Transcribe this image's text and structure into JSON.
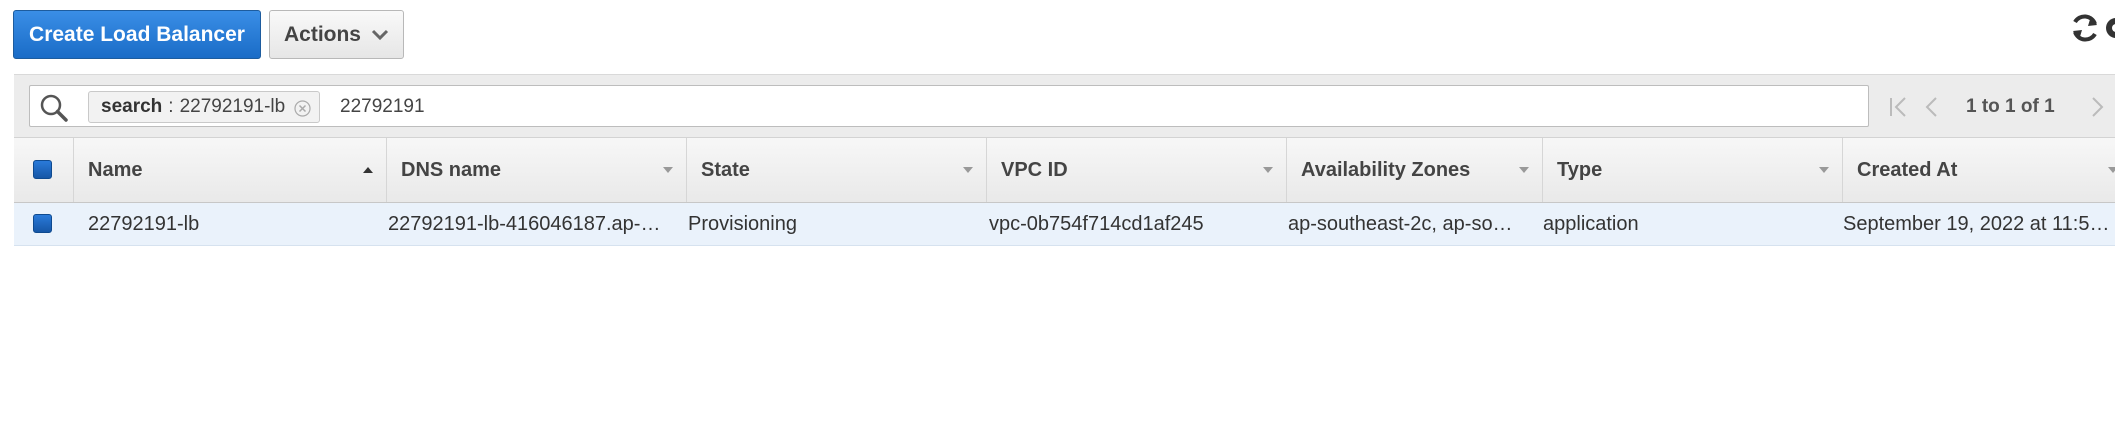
{
  "toolbar": {
    "create_label": "Create Load Balancer",
    "actions_label": "Actions",
    "refresh_icon": "refresh-icon",
    "settings_icon": "gear-icon"
  },
  "filter": {
    "token_key": "search",
    "token_separator": ":",
    "token_value": "22792191-lb",
    "query": "22792191"
  },
  "pagination": {
    "text": "1 to 1 of 1"
  },
  "table": {
    "columns": [
      "Name",
      "DNS name",
      "State",
      "VPC ID",
      "Availability Zones",
      "Type",
      "Created At"
    ],
    "sorted_column": "Name",
    "sort_direction": "ascending",
    "rows": [
      {
        "selected": true,
        "name": "22792191-lb",
        "dns_name": "22792191-lb-416046187.ap-…",
        "state": "Provisioning",
        "vpc_id": "vpc-0b754f714cd1af245",
        "availability_zones": "ap-southeast-2c, ap-so…",
        "type": "application",
        "created_at": "September 19, 2022 at 11:5…"
      }
    ]
  },
  "colors": {
    "primary_button": "#1a6cc7",
    "selected_row": "#eaf2fb",
    "checkbox": "#1a67c0"
  }
}
